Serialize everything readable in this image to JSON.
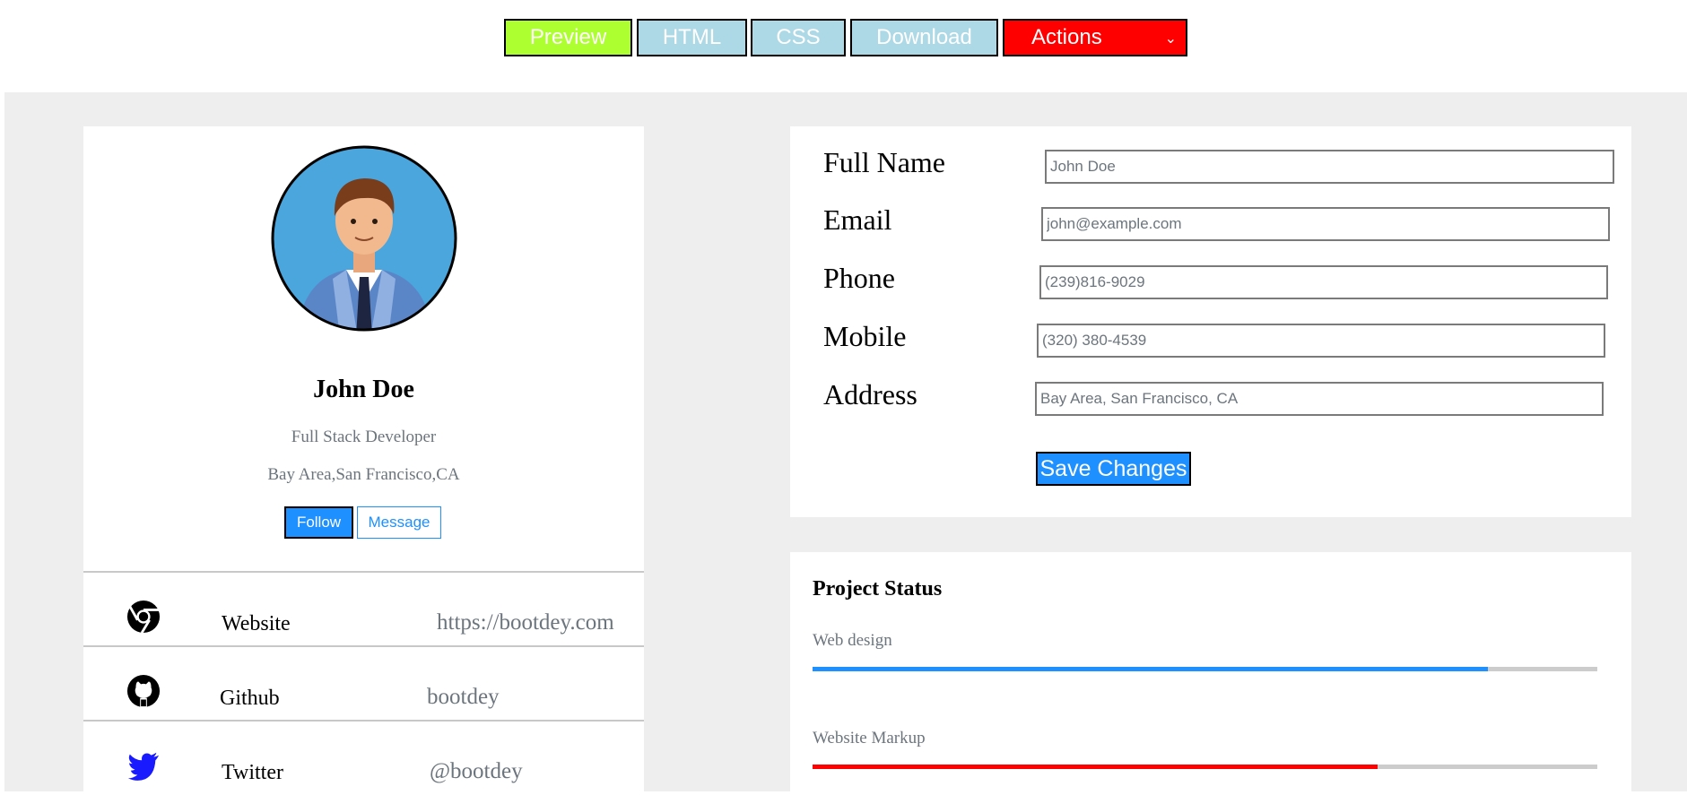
{
  "toolbar": {
    "preview_label": "Preview",
    "html_label": "HTML",
    "css_label": "CSS",
    "download_label": "Download",
    "actions_label": "Actions",
    "actions_icon": "chevron-down-icon",
    "colors": {
      "preview": "#adff2f",
      "tab": "#add8e6",
      "actions": "#ff0000"
    }
  },
  "profile": {
    "name": "John Doe",
    "role": "Full Stack Developer",
    "location": "Bay Area,San Francisco,CA",
    "follow_label": "Follow",
    "message_label": "Message",
    "avatar_icon": "avatar-illustration"
  },
  "social": [
    {
      "icon": "chrome-icon",
      "label": "Website",
      "value": "https://bootdey.com"
    },
    {
      "icon": "github-icon",
      "label": "Github",
      "value": "bootdey"
    },
    {
      "icon": "twitter-icon",
      "label": "Twitter",
      "value": "@bootdey"
    }
  ],
  "form": {
    "fields": [
      {
        "label": "Full Name",
        "placeholder": "John Doe"
      },
      {
        "label": "Email",
        "placeholder": "john@example.com"
      },
      {
        "label": "Phone",
        "placeholder": "(239)816-9029"
      },
      {
        "label": "Mobile",
        "placeholder": "(320) 380-4539"
      },
      {
        "label": "Address",
        "placeholder": "Bay Area, San Francisco, CA"
      }
    ],
    "save_label": "Save Changes"
  },
  "project_status": {
    "title": "Project Status",
    "projects": [
      {
        "label": "Web design",
        "percent": 86,
        "color": "#1e90ff"
      },
      {
        "label": "Website Markup",
        "percent": 72,
        "color": "#ff0000"
      }
    ]
  }
}
